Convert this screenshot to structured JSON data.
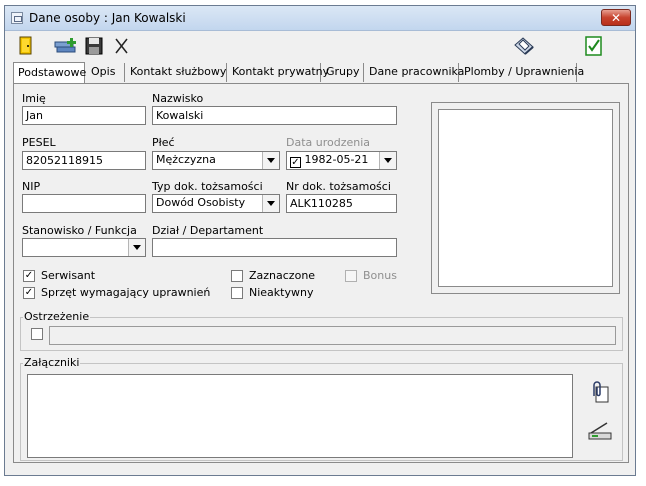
{
  "window": {
    "title": "Dane osoby : Jan Kowalski",
    "close_label": "✕"
  },
  "toolbar": {
    "items": [
      {
        "name": "exit-door-icon"
      },
      {
        "name": "add-record-icon"
      },
      {
        "name": "save-icon"
      },
      {
        "name": "cancel-scissors-icon",
        "glyph": "✂"
      },
      {
        "name": "print-icon"
      },
      {
        "name": "approve-check-icon",
        "glyph": "✓"
      }
    ]
  },
  "tabs": [
    {
      "label": "Podstawowe",
      "active": true
    },
    {
      "label": "Opis"
    },
    {
      "label": "Kontakt służbowy"
    },
    {
      "label": "Kontakt prywatny"
    },
    {
      "label": "Grupy"
    },
    {
      "label": "Dane pracownika"
    },
    {
      "label": "Plomby / Uprawnienia"
    }
  ],
  "form": {
    "first_name": {
      "label": "Imię",
      "value": "Jan"
    },
    "last_name": {
      "label": "Nazwisko",
      "value": "Kowalski"
    },
    "pesel": {
      "label": "PESEL",
      "value": "82052118915"
    },
    "gender": {
      "label": "Płeć",
      "value": "Mężczyzna"
    },
    "birth_date": {
      "label": "Data urodzenia",
      "value": "1982-05-21",
      "checked": "✓"
    },
    "nip": {
      "label": "NIP",
      "value": ""
    },
    "id_type": {
      "label": "Typ dok. tożsamości",
      "value": "Dowód Osobisty"
    },
    "id_number": {
      "label": "Nr dok. tożsamości",
      "value": "ALK110285"
    },
    "position": {
      "label": "Stanowisko / Funkcja",
      "value": ""
    },
    "department": {
      "label": "Dział / Departament",
      "value": ""
    },
    "serwisant": {
      "label": "Serwisant",
      "checked": "✓"
    },
    "sprzet": {
      "label": "Sprzęt wymagający uprawnień",
      "checked": "✓"
    },
    "zaznaczone": {
      "label": "Zaznaczone",
      "checked": ""
    },
    "nieaktywny": {
      "label": "Nieaktywny",
      "checked": ""
    },
    "bonus": {
      "label": "Bonus",
      "checked": ""
    }
  },
  "warning": {
    "label": "Ostrzeżenie",
    "checked": "",
    "value": ""
  },
  "attachments": {
    "label": "Załączniki"
  }
}
